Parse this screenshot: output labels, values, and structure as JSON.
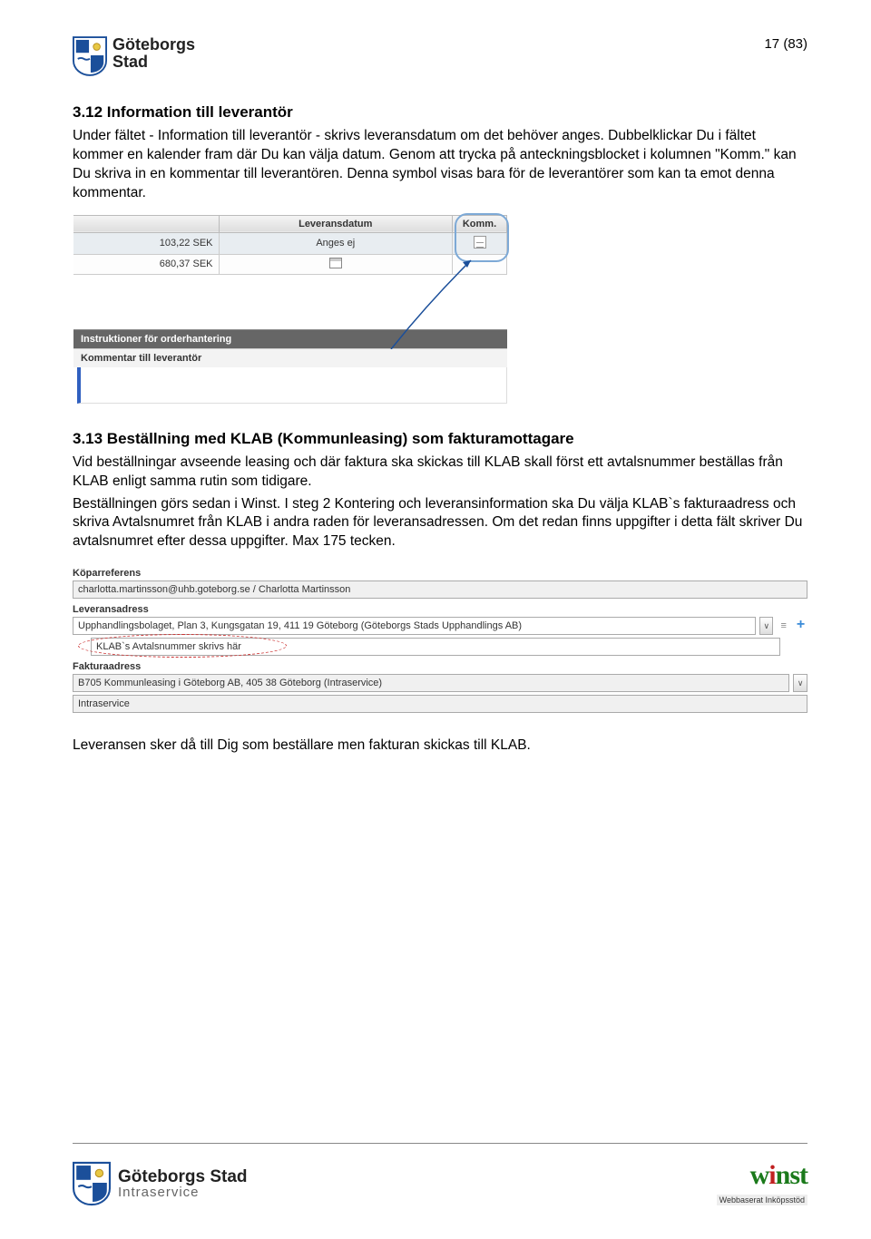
{
  "header": {
    "logo_line1": "Göteborgs",
    "logo_line2": "Stad",
    "page_indicator": "17 (83)"
  },
  "section1": {
    "heading": "3.12 Information till leverantör",
    "p1": "Under fältet - Information till leverantör - skrivs leveransdatum om det behöver anges. Dubbelklickar Du i fältet kommer en kalender fram där Du kan välja datum. Genom att trycka på anteckningsblocket i kolumnen \"Komm.\" kan Du skriva in en kommentar till leverantören. Denna symbol visas bara för de leverantörer som kan ta emot denna kommentar."
  },
  "shot1": {
    "th_blank": "",
    "th_levdat": "Leveransdatum",
    "th_komm": "Komm.",
    "row1_price": "103,22 SEK",
    "row1_anges": "Anges ej",
    "row2_price": "680,37 SEK",
    "panel_bar": "Instruktioner för orderhantering",
    "panel_sub": "Kommentar till leverantör"
  },
  "section2": {
    "heading": "3.13 Beställning med KLAB (Kommunleasing) som fakturamottagare",
    "p1": "Vid beställningar avseende leasing och där faktura ska skickas till KLAB skall först ett avtalsnummer beställas från KLAB enligt samma rutin som tidigare.",
    "p2": "Beställningen görs sedan i Winst. I steg 2 Kontering och leveransinformation ska Du välja KLAB`s fakturaadress och skriva Avtalsnumret från KLAB i andra raden för leveransadressen. Om det redan finns uppgifter i detta fält skriver Du avtalsnumret efter dessa uppgifter. Max 175 tecken."
  },
  "shot2": {
    "label_kopar": "Köparreferens",
    "val_kopar": "charlotta.martinsson@uhb.goteborg.se / Charlotta Martinsson",
    "label_leveransadress": "Leveransadress",
    "val_lev1": "Upphandlingsbolaget, Plan 3, Kungsgatan 19, 411 19 Göteborg (Göteborgs Stads Upphandlings AB)",
    "val_lev2": "KLAB`s Avtalsnummer skrivs här",
    "label_faktura": "Fakturaadress",
    "val_fakt1": "B705 Kommunleasing i Göteborg AB, 405 38 Göteborg (Intraservice)",
    "val_fakt2": "Intraservice"
  },
  "closing": "Leveransen sker då till Dig som beställare men fakturan skickas till KLAB.",
  "footer": {
    "gs1": "Göteborgs Stad",
    "gs2": "Intraservice",
    "winst_w": "w",
    "winst_i": "i",
    "winst_nst": "nst",
    "winst_sub": "Webbaserat Inköpsstöd"
  }
}
